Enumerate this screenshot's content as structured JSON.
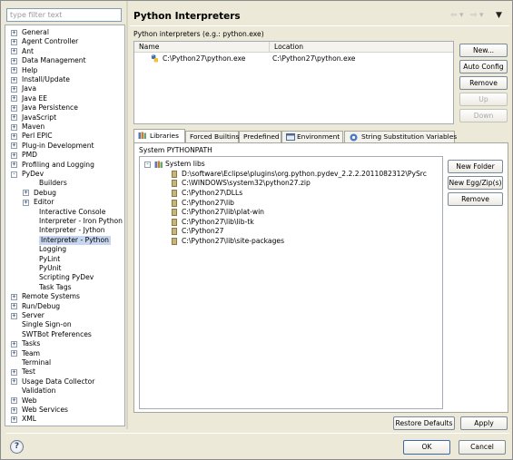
{
  "left_panel": {
    "filter_placeholder": "type filter text",
    "tree_items": [
      {
        "label": "General",
        "expander": "+",
        "depth": 0
      },
      {
        "label": "Agent Controller",
        "expander": "+",
        "depth": 0
      },
      {
        "label": "Ant",
        "expander": "+",
        "depth": 0
      },
      {
        "label": "Data Management",
        "expander": "+",
        "depth": 0
      },
      {
        "label": "Help",
        "expander": "+",
        "depth": 0
      },
      {
        "label": "Install/Update",
        "expander": "+",
        "depth": 0
      },
      {
        "label": "Java",
        "expander": "+",
        "depth": 0
      },
      {
        "label": "Java EE",
        "expander": "+",
        "depth": 0
      },
      {
        "label": "Java Persistence",
        "expander": "+",
        "depth": 0
      },
      {
        "label": "JavaScript",
        "expander": "+",
        "depth": 0
      },
      {
        "label": "Maven",
        "expander": "+",
        "depth": 0
      },
      {
        "label": "Perl EPIC",
        "expander": "+",
        "depth": 0
      },
      {
        "label": "Plug-in Development",
        "expander": "+",
        "depth": 0
      },
      {
        "label": "PMD",
        "expander": "+",
        "depth": 0
      },
      {
        "label": "Profiling and Logging",
        "expander": "+",
        "depth": 0
      },
      {
        "label": "PyDev",
        "expander": "-",
        "depth": 0
      },
      {
        "label": "Builders",
        "expander": "",
        "depth": 2
      },
      {
        "label": "Debug",
        "expander": "+",
        "depth": 1
      },
      {
        "label": "Editor",
        "expander": "+",
        "depth": 1
      },
      {
        "label": "Interactive Console",
        "expander": "",
        "depth": 2
      },
      {
        "label": "Interpreter - Iron Python",
        "expander": "",
        "depth": 2
      },
      {
        "label": "Interpreter - Jython",
        "expander": "",
        "depth": 2
      },
      {
        "label": "Interpreter - Python",
        "expander": "",
        "depth": 2,
        "selected": true
      },
      {
        "label": "Logging",
        "expander": "",
        "depth": 2
      },
      {
        "label": "PyLint",
        "expander": "",
        "depth": 2
      },
      {
        "label": "PyUnit",
        "expander": "",
        "depth": 2
      },
      {
        "label": "Scripting PyDev",
        "expander": "",
        "depth": 2
      },
      {
        "label": "Task Tags",
        "expander": "",
        "depth": 2
      },
      {
        "label": "Remote Systems",
        "expander": "+",
        "depth": 0
      },
      {
        "label": "Run/Debug",
        "expander": "+",
        "depth": 0
      },
      {
        "label": "Server",
        "expander": "+",
        "depth": 0
      },
      {
        "label": "Single Sign-on",
        "expander": "",
        "depth": 0
      },
      {
        "label": "SWTBot Preferences",
        "expander": "",
        "depth": 0
      },
      {
        "label": "Tasks",
        "expander": "+",
        "depth": 0
      },
      {
        "label": "Team",
        "expander": "+",
        "depth": 0
      },
      {
        "label": "Terminal",
        "expander": "",
        "depth": 0
      },
      {
        "label": "Test",
        "expander": "+",
        "depth": 0
      },
      {
        "label": "Usage Data Collector",
        "expander": "+",
        "depth": 0
      },
      {
        "label": "Validation",
        "expander": "",
        "depth": 0
      },
      {
        "label": "Web",
        "expander": "+",
        "depth": 0
      },
      {
        "label": "Web Services",
        "expander": "+",
        "depth": 0
      },
      {
        "label": "XML",
        "expander": "+",
        "depth": 0
      }
    ]
  },
  "header": {
    "title": "Python Interpreters",
    "nav_icons": [
      "back-arrow-icon",
      "forward-arrow-icon",
      "menu-dropdown-icon"
    ]
  },
  "interpreters": {
    "label": "Python interpreters (e.g.: python.exe)",
    "columns": [
      "Name",
      "Location"
    ],
    "rows": [
      {
        "name": "C:\\Python27\\python.exe",
        "location": "C:\\Python27\\python.exe",
        "icon": "python-icon"
      }
    ],
    "buttons": {
      "new": "New...",
      "auto_config": "Auto Config",
      "remove": "Remove",
      "up": "Up",
      "down": "Down"
    }
  },
  "tabs": [
    {
      "label": "Libraries",
      "icon": "libraries-icon",
      "active": true
    },
    {
      "label": "Forced Builtins",
      "icon": "",
      "active": false
    },
    {
      "label": "Predefined",
      "icon": "",
      "active": false
    },
    {
      "label": "Environment",
      "icon": "environment-icon",
      "active": false
    },
    {
      "label": "String Substitution Variables",
      "icon": "variables-icon",
      "active": false
    }
  ],
  "libraries": {
    "label": "System PYTHONPATH",
    "root": {
      "label": "System libs",
      "expander": "-"
    },
    "paths": [
      "D:\\software\\Eclipse\\plugins\\org.python.pydev_2.2.2.2011082312\\PySrc",
      "C:\\WINDOWS\\system32\\python27.zip",
      "C:\\Python27\\DLLs",
      "C:\\Python27\\lib",
      "C:\\Python27\\lib\\plat-win",
      "C:\\Python27\\lib\\lib-tk",
      "C:\\Python27",
      "C:\\Python27\\lib\\site-packages"
    ],
    "buttons": {
      "new_folder": "New Folder",
      "new_egg": "New Egg/Zip(s)",
      "remove": "Remove"
    }
  },
  "footer": {
    "restore_defaults": "Restore Defaults",
    "apply": "Apply",
    "ok": "OK",
    "cancel": "Cancel",
    "help": "?"
  }
}
